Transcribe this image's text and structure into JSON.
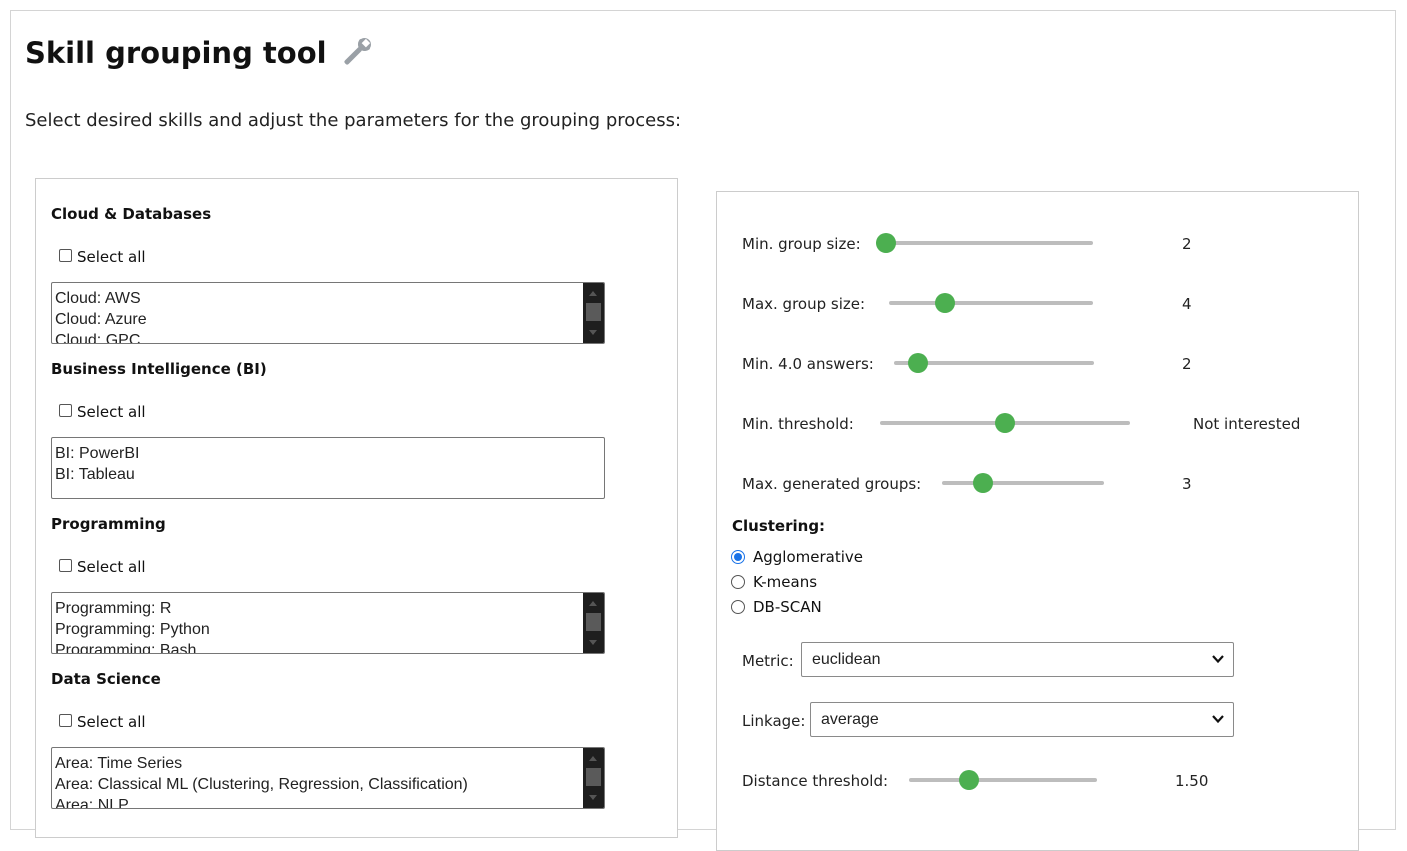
{
  "header": {
    "title": "Skill grouping tool",
    "title_icon": "wrench-icon",
    "subtitle": "Select desired skills and adjust the parameters for the grouping process:"
  },
  "categories": [
    {
      "title": "Cloud & Databases",
      "select_all": "Select all",
      "options": [
        "Cloud: AWS",
        "Cloud: Azure",
        "Cloud: GPC"
      ],
      "scrollable": true
    },
    {
      "title": "Business Intelligence (BI)",
      "select_all": "Select all",
      "options": [
        "BI: PowerBI",
        "BI: Tableau"
      ],
      "scrollable": false
    },
    {
      "title": "Programming",
      "select_all": "Select all",
      "options": [
        "Programming: R",
        "Programming: Python",
        "Programming: Bash"
      ],
      "scrollable": true
    },
    {
      "title": "Data Science",
      "select_all": "Select all",
      "options": [
        "Area: Time Series",
        "Area: Classical ML (Clustering, Regression, Classification)",
        "Area: NLP"
      ],
      "scrollable": true
    }
  ],
  "parameters": [
    {
      "label": "Min. group size:",
      "value": "2",
      "fraction": 0.0
    },
    {
      "label": "Max. group size:",
      "value": "4",
      "fraction": 0.25
    },
    {
      "label": "Min. 4.0 answers:",
      "value": "2",
      "fraction": 0.08
    },
    {
      "label": "Min. threshold:",
      "value": "Not interested",
      "fraction": 0.5
    },
    {
      "label": "Max. generated groups:",
      "value": "3",
      "fraction": 0.22
    }
  ],
  "clustering": {
    "title": "Clustering:",
    "options": [
      "Agglomerative",
      "K-means",
      "DB-SCAN"
    ],
    "selected": "Agglomerative"
  },
  "metric": {
    "label": "Metric:",
    "value": "euclidean"
  },
  "linkage": {
    "label": "Linkage:",
    "value": "average"
  },
  "distance_threshold": {
    "label": "Distance threshold:",
    "value": "1.50",
    "fraction": 0.3
  },
  "colors": {
    "accent": "#4caf50",
    "radio": "#1a73e8"
  }
}
